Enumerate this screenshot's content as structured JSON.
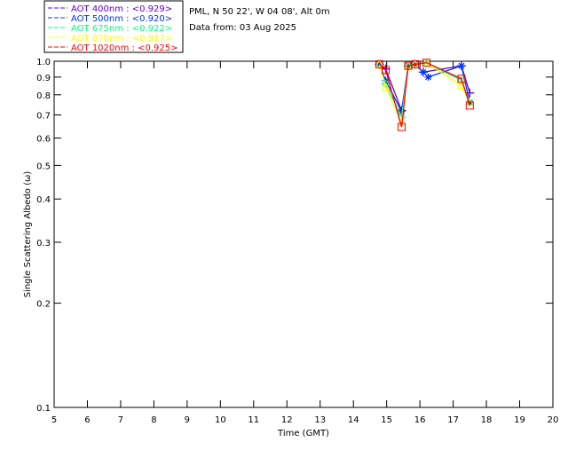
{
  "chart_data": {
    "type": "line",
    "header": [
      "PML, N 50 22', W 04 08', Alt 0m",
      "Data from: 03 Aug 2025"
    ],
    "xlabel": "Time (GMT)",
    "ylabel": "Single Scattering Albedo (ω)",
    "xlim": [
      5,
      20
    ],
    "ylim": [
      0.1,
      1.0
    ],
    "yscale": "log",
    "xticks": [
      5,
      6,
      7,
      8,
      9,
      10,
      11,
      12,
      13,
      14,
      15,
      16,
      17,
      18,
      19,
      20
    ],
    "yticks": [
      "0.1",
      "0.2",
      "0.3",
      "0.4",
      "0.5",
      "0.6",
      "0.7",
      "0.8",
      "0.9",
      "1.0"
    ],
    "legend_placement": "top-left outside",
    "series": [
      {
        "name": "AOT  400nm : <0.929>",
        "color": "#6600cc",
        "marker": "plus",
        "x": [
          14.78,
          14.97,
          15.45,
          15.65,
          15.85,
          16.1,
          17.25,
          17.5
        ],
        "y": [
          0.98,
          0.95,
          0.72,
          0.97,
          0.98,
          0.93,
          0.97,
          0.81
        ]
      },
      {
        "name": "AOT  500nm : <0.920>",
        "color": "#0033ff",
        "marker": "asterisk",
        "x": [
          14.78,
          14.97,
          15.45,
          15.65,
          15.85,
          16.1,
          16.25,
          17.25,
          17.5
        ],
        "y": [
          0.98,
          0.88,
          0.715,
          0.97,
          0.98,
          0.93,
          0.9,
          0.97,
          0.76
        ]
      },
      {
        "name": "AOT  675nm : <0.922>",
        "color": "#00ff80",
        "marker": "diamond",
        "x": [
          14.78,
          14.97,
          15.45,
          15.65,
          15.85,
          16.2,
          17.25,
          17.5
        ],
        "y": [
          0.98,
          0.86,
          0.69,
          0.97,
          0.98,
          0.99,
          0.88,
          0.76
        ]
      },
      {
        "name": "AOT  870nm : <0.917>",
        "color": "#ffff00",
        "marker": "triangle",
        "x": [
          14.78,
          14.97,
          15.45,
          15.65,
          15.85,
          16.2,
          17.25,
          17.5
        ],
        "y": [
          0.98,
          0.84,
          0.665,
          0.97,
          0.98,
          0.99,
          0.85,
          0.76
        ]
      },
      {
        "name": "AOT 1020nm : <0.925>",
        "color": "#ff0000",
        "marker": "square",
        "x": [
          14.78,
          14.97,
          15.45,
          15.65,
          15.85,
          16.2,
          17.25,
          17.5
        ],
        "y": [
          0.98,
          0.943,
          0.646,
          0.97,
          0.98,
          0.99,
          0.89,
          0.745
        ]
      }
    ]
  }
}
